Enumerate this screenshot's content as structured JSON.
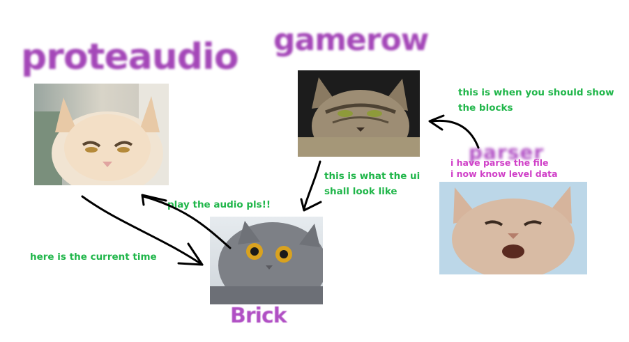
{
  "nodes": {
    "proteaudio": {
      "label": "proteaudio"
    },
    "gamerow": {
      "label": "gamerow"
    },
    "brick": {
      "label": "Brick"
    },
    "parser": {
      "label": "parser"
    }
  },
  "notes": {
    "show_blocks": [
      "this is when you should show",
      "the blocks"
    ],
    "ui_look": [
      "this is what the ui",
      "shall look like"
    ],
    "play_audio": "play the audio pls!!",
    "current_time": "here is the current time",
    "parser_status": [
      "i have parse the file",
      "i now know level data"
    ]
  },
  "colors": {
    "title": "#a447b8",
    "note": "#20b64a",
    "parser_note": "#d040c8",
    "arrow": "#000000"
  },
  "images": {
    "proteaudio": "angry-cream-cat-photo",
    "gamerow": "tabby-cat-squinting-photo",
    "brick": "grey-british-shorthair-surprised-photo",
    "parser": "cream-cat-meowing-photo"
  }
}
